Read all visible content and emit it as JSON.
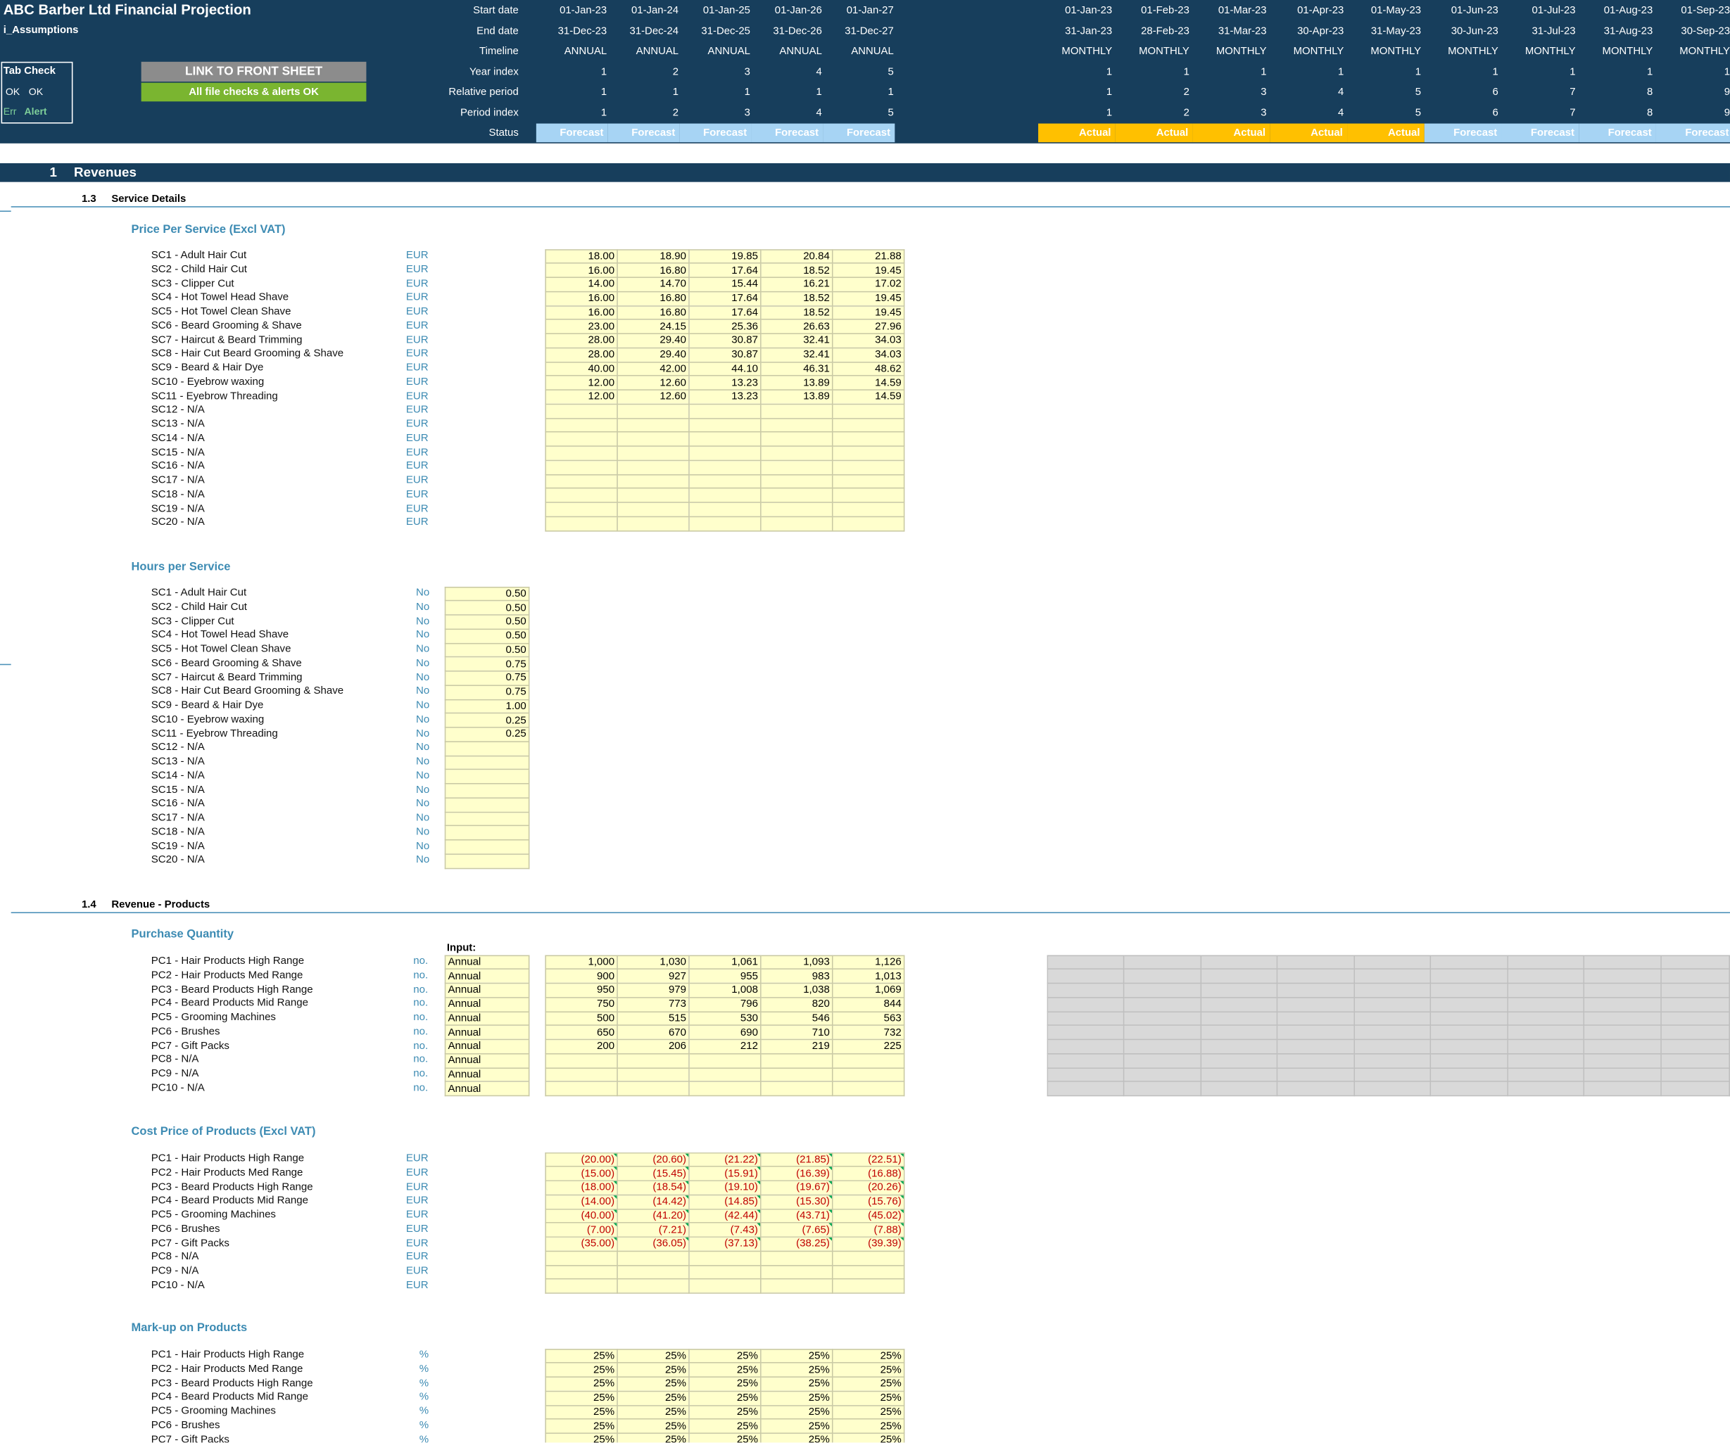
{
  "header": {
    "title": "ABC Barber Ltd Financial Projection",
    "sheet": "i_Assumptions",
    "row_labels": [
      "Start date",
      "End date",
      "Timeline",
      "Year index",
      "Relative period",
      "Period index",
      "Status"
    ],
    "annual": {
      "start": [
        "01-Jan-23",
        "01-Jan-24",
        "01-Jan-25",
        "01-Jan-26",
        "01-Jan-27"
      ],
      "end": [
        "31-Dec-23",
        "31-Dec-24",
        "31-Dec-25",
        "31-Dec-26",
        "31-Dec-27"
      ],
      "timeline": [
        "ANNUAL",
        "ANNUAL",
        "ANNUAL",
        "ANNUAL",
        "ANNUAL"
      ],
      "year_index": [
        "1",
        "2",
        "3",
        "4",
        "5"
      ],
      "relative": [
        "1",
        "1",
        "1",
        "1",
        "1"
      ],
      "period_index": [
        "1",
        "2",
        "3",
        "4",
        "5"
      ],
      "status": [
        "Forecast",
        "Forecast",
        "Forecast",
        "Forecast",
        "Forecast"
      ]
    },
    "monthly": {
      "start": [
        "01-Jan-23",
        "01-Feb-23",
        "01-Mar-23",
        "01-Apr-23",
        "01-May-23",
        "01-Jun-23",
        "01-Jul-23",
        "01-Aug-23",
        "01-Sep-23"
      ],
      "end": [
        "31-Jan-23",
        "28-Feb-23",
        "31-Mar-23",
        "30-Apr-23",
        "31-May-23",
        "30-Jun-23",
        "31-Jul-23",
        "31-Aug-23",
        "30-Sep-23"
      ],
      "timeline": [
        "MONTHLY",
        "MONTHLY",
        "MONTHLY",
        "MONTHLY",
        "MONTHLY",
        "MONTHLY",
        "MONTHLY",
        "MONTHLY",
        "MONTHLY"
      ],
      "year_index": [
        "1",
        "1",
        "1",
        "1",
        "1",
        "1",
        "1",
        "1",
        "1"
      ],
      "relative": [
        "1",
        "2",
        "3",
        "4",
        "5",
        "6",
        "7",
        "8",
        "9"
      ],
      "period_index": [
        "1",
        "2",
        "3",
        "4",
        "5",
        "6",
        "7",
        "8",
        "9"
      ],
      "status": [
        "Actual",
        "Actual",
        "Actual",
        "Actual",
        "Actual",
        "Forecast",
        "Forecast",
        "Forecast",
        "Forecast"
      ]
    },
    "tab_check": {
      "label": "Tab Check",
      "ok1": "OK",
      "ok2": "OK",
      "err": "Err",
      "alert": "Alert"
    },
    "link_button": "LINK TO FRONT SHEET",
    "checks_status": "All file checks & alerts OK"
  },
  "section": {
    "num": "1",
    "title": "Revenues"
  },
  "service": {
    "num": "1.3",
    "title": "Service Details",
    "price_title": "Price Per Service (Excl VAT)",
    "hours_title": "Hours per Service",
    "unit_price": "EUR",
    "unit_hours": "No",
    "items": [
      "SC1 - Adult Hair Cut",
      "SC2 - Child Hair Cut",
      "SC3 - Clipper Cut",
      "SC4 - Hot Towel Head Shave",
      "SC5 - Hot Towel Clean Shave",
      "SC6 - Beard Grooming & Shave",
      "SC7 - Haircut & Beard Trimming",
      "SC8 - Hair Cut Beard Grooming & Shave",
      "SC9 - Beard & Hair Dye",
      "SC10 - Eyebrow waxing",
      "SC11 - Eyebrow Threading",
      "SC12 - N/A",
      "SC13 - N/A",
      "SC14 - N/A",
      "SC15 - N/A",
      "SC16 - N/A",
      "SC17 - N/A",
      "SC18 - N/A",
      "SC19 - N/A",
      "SC20 - N/A"
    ],
    "prices": [
      [
        "18.00",
        "18.90",
        "19.85",
        "20.84",
        "21.88"
      ],
      [
        "16.00",
        "16.80",
        "17.64",
        "18.52",
        "19.45"
      ],
      [
        "14.00",
        "14.70",
        "15.44",
        "16.21",
        "17.02"
      ],
      [
        "16.00",
        "16.80",
        "17.64",
        "18.52",
        "19.45"
      ],
      [
        "16.00",
        "16.80",
        "17.64",
        "18.52",
        "19.45"
      ],
      [
        "23.00",
        "24.15",
        "25.36",
        "26.63",
        "27.96"
      ],
      [
        "28.00",
        "29.40",
        "30.87",
        "32.41",
        "34.03"
      ],
      [
        "28.00",
        "29.40",
        "30.87",
        "32.41",
        "34.03"
      ],
      [
        "40.00",
        "42.00",
        "44.10",
        "46.31",
        "48.62"
      ],
      [
        "12.00",
        "12.60",
        "13.23",
        "13.89",
        "14.59"
      ],
      [
        "12.00",
        "12.60",
        "13.23",
        "13.89",
        "14.59"
      ],
      [
        "",
        "",
        "",
        "",
        ""
      ],
      [
        "",
        "",
        "",
        "",
        ""
      ],
      [
        "",
        "",
        "",
        "",
        ""
      ],
      [
        "",
        "",
        "",
        "",
        ""
      ],
      [
        "",
        "",
        "",
        "",
        ""
      ],
      [
        "",
        "",
        "",
        "",
        ""
      ],
      [
        "",
        "",
        "",
        "",
        ""
      ],
      [
        "",
        "",
        "",
        "",
        ""
      ],
      [
        "",
        "",
        "",
        "",
        ""
      ]
    ],
    "hours": [
      "0.50",
      "0.50",
      "0.50",
      "0.50",
      "0.50",
      "0.75",
      "0.75",
      "0.75",
      "1.00",
      "0.25",
      "0.25",
      "",
      "",
      "",
      "",
      "",
      "",
      "",
      "",
      ""
    ]
  },
  "products": {
    "num": "1.4",
    "title": "Revenue - Products",
    "qty_title": "Purchase Quantity",
    "input_label": "Input:",
    "cost_title": "Cost Price of Products (Excl VAT)",
    "markup_title": "Mark-up on Products",
    "unit_qty": "no.",
    "unit_cost": "EUR",
    "unit_markup": "%",
    "items": [
      "PC1 - Hair Products High Range",
      "PC2 - Hair Products Med Range",
      "PC3 - Beard Products High Range",
      "PC4 - Beard Products Mid Range",
      "PC5 - Grooming Machines",
      "PC6 - Brushes",
      "PC7 - Gift Packs",
      "PC8 - N/A",
      "PC9 - N/A",
      "PC10 - N/A"
    ],
    "freq": [
      "Annual",
      "Annual",
      "Annual",
      "Annual",
      "Annual",
      "Annual",
      "Annual",
      "Annual",
      "Annual",
      "Annual"
    ],
    "qty": [
      [
        "1,000",
        "1,030",
        "1,061",
        "1,093",
        "1,126"
      ],
      [
        "900",
        "927",
        "955",
        "983",
        "1,013"
      ],
      [
        "950",
        "979",
        "1,008",
        "1,038",
        "1,069"
      ],
      [
        "750",
        "773",
        "796",
        "820",
        "844"
      ],
      [
        "500",
        "515",
        "530",
        "546",
        "563"
      ],
      [
        "650",
        "670",
        "690",
        "710",
        "732"
      ],
      [
        "200",
        "206",
        "212",
        "219",
        "225"
      ],
      [
        "",
        "",
        "",
        "",
        ""
      ],
      [
        "",
        "",
        "",
        "",
        ""
      ],
      [
        "",
        "",
        "",
        "",
        ""
      ]
    ],
    "cost": [
      [
        "(20.00)",
        "(20.60)",
        "(21.22)",
        "(21.85)",
        "(22.51)"
      ],
      [
        "(15.00)",
        "(15.45)",
        "(15.91)",
        "(16.39)",
        "(16.88)"
      ],
      [
        "(18.00)",
        "(18.54)",
        "(19.10)",
        "(19.67)",
        "(20.26)"
      ],
      [
        "(14.00)",
        "(14.42)",
        "(14.85)",
        "(15.30)",
        "(15.76)"
      ],
      [
        "(40.00)",
        "(41.20)",
        "(42.44)",
        "(43.71)",
        "(45.02)"
      ],
      [
        "(7.00)",
        "(7.21)",
        "(7.43)",
        "(7.65)",
        "(7.88)"
      ],
      [
        "(35.00)",
        "(36.05)",
        "(37.13)",
        "(38.25)",
        "(39.39)"
      ],
      [
        "",
        "",
        "",
        "",
        ""
      ],
      [
        "",
        "",
        "",
        "",
        ""
      ],
      [
        "",
        "",
        "",
        "",
        ""
      ]
    ],
    "markup_items": [
      "PC1 - Hair Products High Range",
      "PC2 - Hair Products Med Range",
      "PC3 - Beard Products High Range",
      "PC4 - Beard Products Mid Range",
      "PC5 - Grooming Machines",
      "PC6 - Brushes",
      "PC7 - Gift Packs"
    ],
    "markup": [
      [
        "25%",
        "25%",
        "25%",
        "25%",
        "25%"
      ],
      [
        "25%",
        "25%",
        "25%",
        "25%",
        "25%"
      ],
      [
        "25%",
        "25%",
        "25%",
        "25%",
        "25%"
      ],
      [
        "25%",
        "25%",
        "25%",
        "25%",
        "25%"
      ],
      [
        "25%",
        "25%",
        "25%",
        "25%",
        "25%"
      ],
      [
        "25%",
        "25%",
        "25%",
        "25%",
        "25%"
      ],
      [
        "25%",
        "25%",
        "25%",
        "25%",
        "25%"
      ]
    ]
  }
}
